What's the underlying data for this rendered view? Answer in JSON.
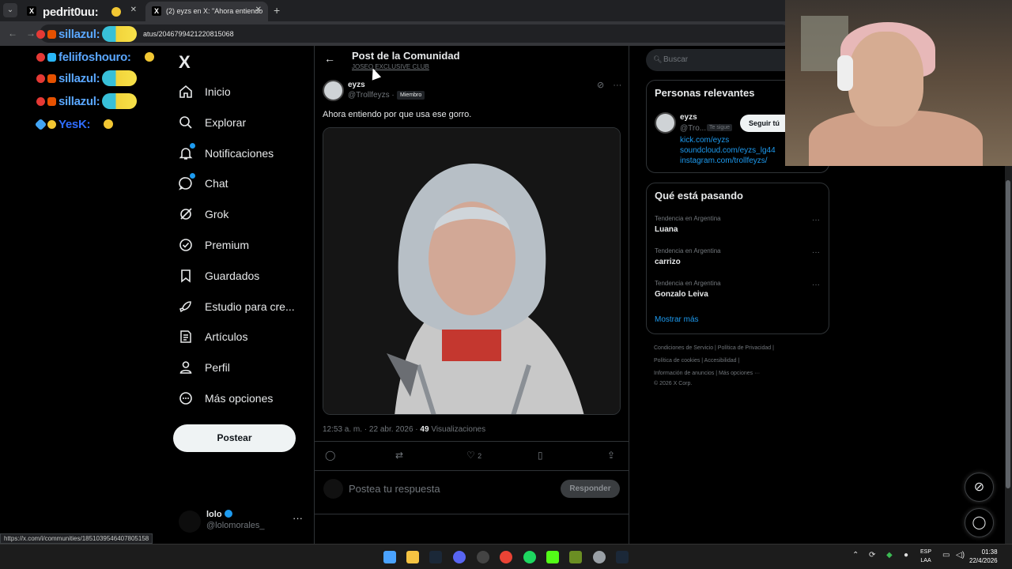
{
  "browser": {
    "tabs": [
      {
        "title": "",
        "favicon": "X"
      },
      {
        "title": "(2) eyzs en X: \"Ahora entiendo",
        "favicon": "X"
      }
    ],
    "url_fragment": "atus/2046799421220815068",
    "status_url": "https://x.com/i/communities/1851039546407805158"
  },
  "chat": [
    {
      "name": "pedrit0uu:",
      "color": "#f0f0f0"
    },
    {
      "name": "sillazul:",
      "color": "#5aa7ff"
    },
    {
      "name": "feliifoshouro:",
      "color": "#5aa7ff"
    },
    {
      "name": "sillazul:",
      "color": "#5aa7ff"
    },
    {
      "name": "sillazul:",
      "color": "#5aa7ff"
    },
    {
      "name": "YesK:",
      "color": "#2f6dff"
    }
  ],
  "nav": {
    "logo": "X",
    "items": [
      {
        "label": "Inicio",
        "icon": "home-icon"
      },
      {
        "label": "Explorar",
        "icon": "search-icon"
      },
      {
        "label": "Notificaciones",
        "icon": "bell-icon"
      },
      {
        "label": "Chat",
        "icon": "chat-icon"
      },
      {
        "label": "Grok",
        "icon": "grok-icon"
      },
      {
        "label": "Premium",
        "icon": "premium-icon"
      },
      {
        "label": "Guardados",
        "icon": "bookmark-icon"
      },
      {
        "label": "Estudio para cre...",
        "icon": "rocket-icon"
      },
      {
        "label": "Artículos",
        "icon": "article-icon"
      },
      {
        "label": "Perfil",
        "icon": "person-icon"
      },
      {
        "label": "Más opciones",
        "icon": "more-icon"
      }
    ],
    "post_button": "Postear",
    "account": {
      "name": "lolo",
      "handle": "@lolomorales_"
    }
  },
  "post": {
    "header_title": "Post de la Comunidad",
    "community": "JOSEO EXCLUSIVE CLUB",
    "author_name": "eyzs",
    "author_handle": "@Trollfeyzs ·",
    "member_badge": "Miembro",
    "text": "Ahora entiendo por que usa ese gorro.",
    "time": "12:53 a. m. · 22 abr. 2026 ·",
    "views": "49",
    "views_label": "Visualizaciones",
    "likes": "2",
    "reply_placeholder": "Postea tu respuesta",
    "reply_button": "Responder"
  },
  "sidebar": {
    "search_placeholder": "Buscar",
    "relevant_title": "Personas relevantes",
    "relevant": {
      "name": "eyzs",
      "handle": "@Tro...",
      "follows_you": "Te sigue",
      "follow_button": "Seguir tú",
      "links": [
        "kick.com/eyzs",
        "soundcloud.com/eyzs_lg44",
        "instagram.com/trollfeyzs/"
      ]
    },
    "trends_title": "Qué está pasando",
    "trends": [
      {
        "category": "Tendencia en Argentina",
        "name": "Luana"
      },
      {
        "category": "Tendencia en Argentina",
        "name": "carrizo"
      },
      {
        "category": "Tendencia en Argentina",
        "name": "Gonzalo Leiva"
      }
    ],
    "show_more": "Mostrar más",
    "footer": [
      "Condiciones de Servicio  |  Política de Privacidad  |",
      "Política de cookies  |  Accesibilidad  |",
      "Información de anuncios  |  Más opciones ···",
      "© 2026 X Corp."
    ]
  },
  "taskbar": {
    "lang_top": "ESP",
    "lang_bottom": "LAA",
    "time": "01:38",
    "date": "22/4/2026"
  }
}
